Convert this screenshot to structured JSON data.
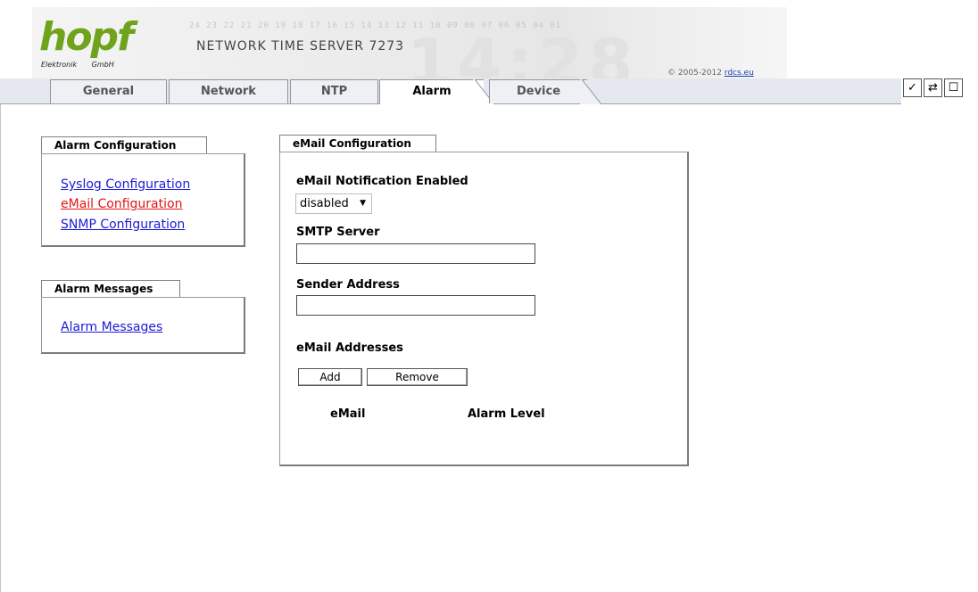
{
  "header": {
    "logo_text": "hopf",
    "logo_sub_left": "Elektronik",
    "logo_sub_right": "GmbH",
    "product_title": "NETWORK TIME SERVER 7273",
    "copyright_prefix": "© 2005-2012",
    "copyright_link": "rdcs.eu",
    "background_digits": "24 23 22 21 20 19 18 17 16 15 14 13 12 11 10 09 08 07 06 05 04 01",
    "background_clock": "14:28"
  },
  "tabs": [
    {
      "label": "General"
    },
    {
      "label": "Network"
    },
    {
      "label": "NTP"
    },
    {
      "label": "Alarm",
      "active": true
    },
    {
      "label": "Device"
    }
  ],
  "toolbar": {
    "icons": [
      "checkmark-icon",
      "refresh-arrows-icon",
      "document-icon"
    ],
    "glyphs": [
      "✓",
      "⇄",
      "☐"
    ]
  },
  "sidebar": {
    "alarm_config_title": "Alarm Configuration",
    "links": [
      {
        "label": "Syslog Configuration",
        "active": false
      },
      {
        "label": "eMail Configuration",
        "active": true
      },
      {
        "label": "SNMP Configuration",
        "active": false
      }
    ],
    "alarm_messages_title": "Alarm Messages",
    "alarm_messages_link": "Alarm Messages"
  },
  "email_config": {
    "title": "eMail Configuration",
    "notification_label": "eMail Notification Enabled",
    "notification_value": "disabled",
    "smtp_label": "SMTP Server",
    "smtp_value": "",
    "sender_label": "Sender Address",
    "sender_value": "",
    "addresses_label": "eMail Addresses",
    "add_button": "Add",
    "remove_button": "Remove",
    "col_email": "eMail",
    "col_alarm_level": "Alarm Level"
  },
  "colors": {
    "logo_green": "#6ea31b",
    "link_blue": "#1b1bd6",
    "link_active_red": "#e01414"
  }
}
